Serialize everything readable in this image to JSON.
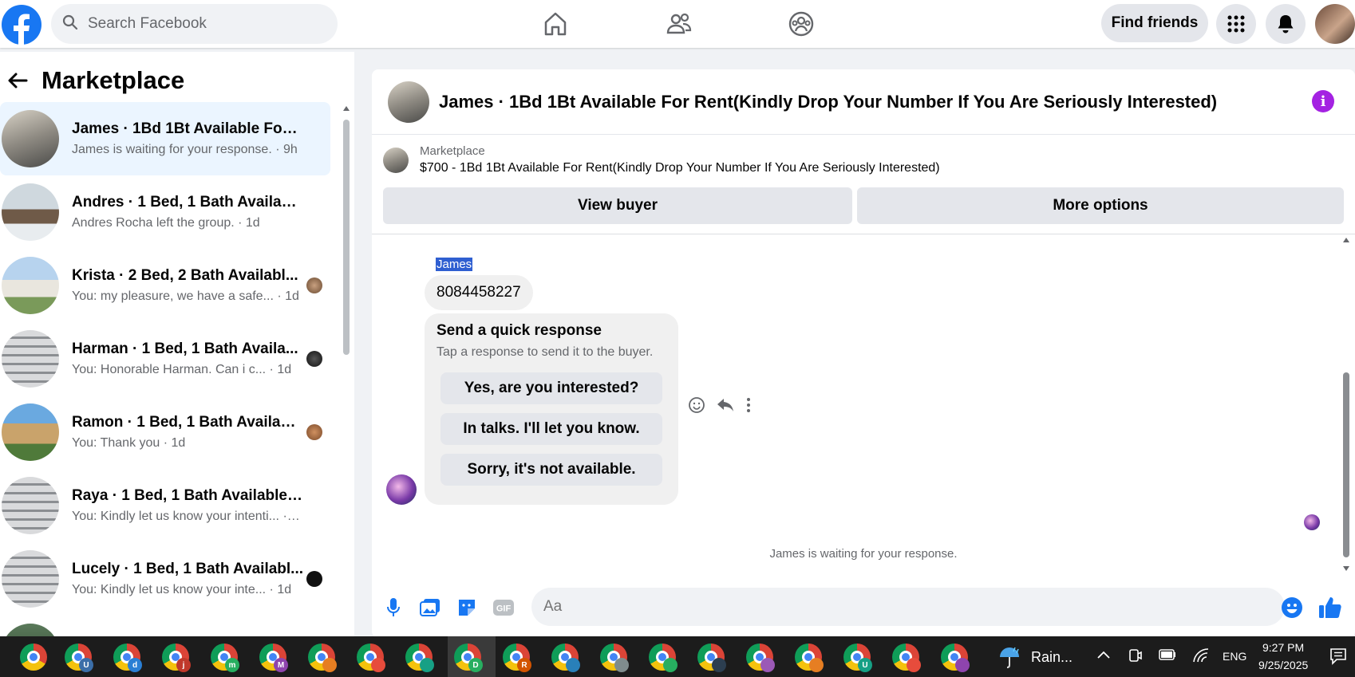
{
  "topbar": {
    "search_placeholder": "Search Facebook",
    "find_friends_label": "Find friends"
  },
  "sidebar": {
    "title": "Marketplace",
    "conversations": [
      {
        "name": "James · 1Bd 1Bt Available For Re...",
        "preview": "James is waiting for your response. · 9h",
        "active": true
      },
      {
        "name": "Andres · 1 Bed, 1 Bath Available ...",
        "preview": "Andres Rocha left the group. · 1d",
        "active": false
      },
      {
        "name": "Krista · 2 Bed, 2 Bath Availabl...",
        "preview": "You: my pleasure, we have a safe... · 1d",
        "active": false
      },
      {
        "name": "Harman · 1 Bed, 1 Bath Availa...",
        "preview": "You: Honorable Harman. Can i c... · 1d",
        "active": false
      },
      {
        "name": "Ramon · 1 Bed, 1 Bath Availabl...",
        "preview": "You: Thank you · 1d",
        "active": false
      },
      {
        "name": "Raya · 1 Bed, 1 Bath Available Fo...",
        "preview": "You: Kindly let us know your intenti... · 1d",
        "active": false
      },
      {
        "name": "Lucely · 1 Bed, 1 Bath Availabl...",
        "preview": "You: Kindly let us know your inte... · 1d",
        "active": false
      }
    ]
  },
  "chat": {
    "title": "James · 1Bd 1Bt Available For Rent(Kindly Drop Your Number If You Are Seriously Interested)",
    "listing": {
      "source": "Marketplace",
      "description": "$700 - 1Bd 1Bt Available For Rent(Kindly Drop Your Number If You Are Seriously Interested)"
    },
    "view_buyer_label": "View buyer",
    "more_options_label": "More options",
    "sender_name": "James",
    "message": "8084458227",
    "quick_response": {
      "title": "Send a quick response",
      "subtitle": "Tap a response to send it to the buyer.",
      "options": [
        "Yes, are you interested?",
        "In talks. I'll let you know.",
        "Sorry, it's not available."
      ]
    },
    "status": "James is waiting for your response.",
    "composer_placeholder": "Aa"
  },
  "taskbar": {
    "weather": "Rain...",
    "language": "ENG",
    "time": "9:27 PM",
    "date": "9/25/2025",
    "app_badges": [
      "U",
      "d",
      "j",
      "m",
      "M",
      "",
      "",
      "",
      "D",
      "R",
      "",
      "",
      "",
      "",
      "",
      "",
      "U",
      "",
      ""
    ]
  },
  "colors": {
    "brand_blue": "#1877f2",
    "active_conversation_bg": "#ebf5ff",
    "info_purple": "#a422e2",
    "taskbar_bg": "#1c1c1c"
  }
}
